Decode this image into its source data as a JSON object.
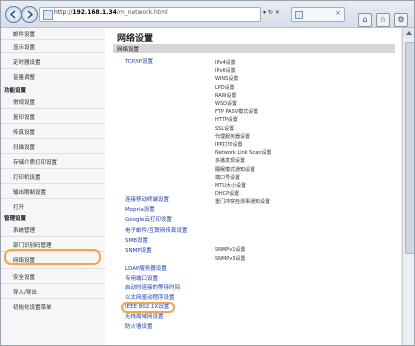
{
  "browser": {
    "url_scheme": "http://",
    "url_host": "192.168.1.34",
    "url_path": "/m_network.html",
    "address_actions": "▾ ↻ ✕",
    "tab_title": "",
    "controls": [
      "⌂",
      "☆",
      "⚙"
    ]
  },
  "sidebar": {
    "items_top": [
      {
        "label": "邮件设置"
      },
      {
        "label": "显示设置"
      },
      {
        "label": "定时器设置"
      },
      {
        "label": "音量调整"
      }
    ],
    "group1_title": "功能设置",
    "group1_items": [
      {
        "label": "常规设置"
      },
      {
        "label": "复印设置"
      },
      {
        "label": "传真设置"
      },
      {
        "label": "扫描设置"
      },
      {
        "label": "存储介质打印设置"
      },
      {
        "label": "打印机设置"
      },
      {
        "label": "输出限制设置"
      },
      {
        "label": "打开"
      }
    ],
    "group2_title": "管理设置",
    "group2_items": [
      {
        "label": "系统管理"
      },
      {
        "label": "部门识别码管理"
      },
      {
        "label": "网络设置"
      },
      {
        "label": "安全设置"
      },
      {
        "label": "导入/导出"
      },
      {
        "label": "初始化设置菜单"
      }
    ]
  },
  "main": {
    "title": "网络设置",
    "section": "网络设置",
    "tcpip_link": "TCP/IP设置",
    "tcpip_subitems": [
      "IPv4设置",
      "IPv6设置",
      "WINS设置",
      "LPD设置",
      "RAW设置",
      "WSD设置",
      "FTP PASV模式设置",
      "HTTP设置",
      "SSL设置",
      "代理服务器设置",
      "IPP打印设置",
      "Network Link Scan设置",
      "多播发现设置",
      "睡眠模式通知设置",
      "端口号设置",
      "MTU大小设置",
      "DHCP设置",
      "重门冲突检测事通知设置"
    ],
    "other_links_1": [
      "连接移动终端设置",
      "Mopria设置",
      "Google云打印设置",
      "电子邮件/互联网传真设置",
      "SMB设置"
    ],
    "snmp_link": "SNMP设置",
    "snmp_subitems": [
      "SNMPv1设置",
      "SNMPv3设置"
    ],
    "other_links_2": [
      "LDAP服务器设置",
      "专用端口设置",
      "启动时连接的等待时间",
      "以太网驱动程序设置",
      "IEEE 802.1X设置",
      "无线局域网设置",
      "防火墙设置"
    ]
  },
  "colors": {
    "highlight": "#f3a64a",
    "link": "#1a3aaa"
  }
}
